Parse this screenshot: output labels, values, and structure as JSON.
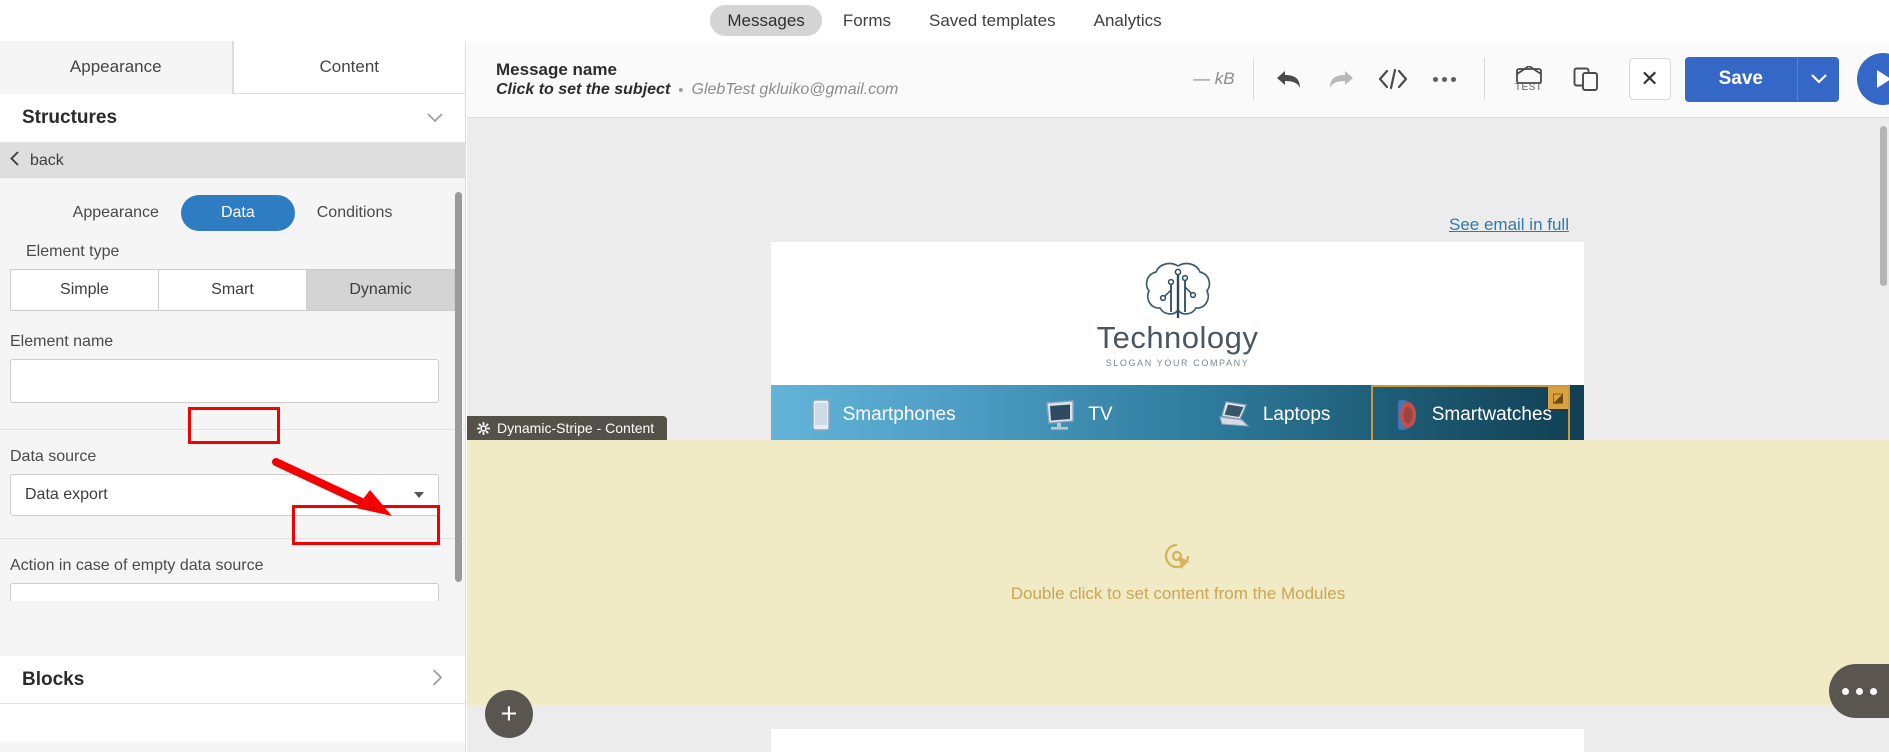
{
  "topnav": {
    "items": [
      {
        "label": "Messages",
        "active": true
      },
      {
        "label": "Forms",
        "active": false
      },
      {
        "label": "Saved templates",
        "active": false
      },
      {
        "label": "Analytics",
        "active": false
      }
    ]
  },
  "left_panel": {
    "top_tabs": [
      {
        "label": "Appearance",
        "active": true
      },
      {
        "label": "Content",
        "active": false
      }
    ],
    "structures_title": "Structures",
    "back_label": "back",
    "sub_tabs": [
      {
        "label": "Appearance",
        "active": false
      },
      {
        "label": "Data",
        "active": true
      },
      {
        "label": "Conditions",
        "active": false
      }
    ],
    "element_type_label": "Element type",
    "element_types": [
      {
        "label": "Simple",
        "selected": false
      },
      {
        "label": "Smart",
        "selected": false
      },
      {
        "label": "Dynamic",
        "selected": true
      }
    ],
    "element_name_label": "Element name",
    "element_name_value": "",
    "element_name_placeholder": "",
    "data_source_label": "Data source",
    "data_source_value": "Data export",
    "empty_action_label": "Action in case of empty data source",
    "blocks_title": "Blocks",
    "highlight_color": "#f40000",
    "accent_color": "#2e7cc2"
  },
  "editor_header": {
    "message_name": "Message name",
    "subject_placeholder": "Click to set the subject",
    "separator": "•",
    "sender": "GlebTest gkluiko@gmail.com",
    "size": "— kB",
    "icons": [
      {
        "name": "undo-icon",
        "title": "Undo"
      },
      {
        "name": "redo-icon",
        "title": "Redo"
      },
      {
        "name": "code-icon",
        "title": "</>"
      },
      {
        "name": "more-icon",
        "title": "More"
      },
      {
        "name": "test-email-icon",
        "title": "TEST"
      },
      {
        "name": "duplicate-icon",
        "title": "Copy"
      }
    ],
    "test_label": "TEST",
    "close_label": "✕",
    "save_label": "Save",
    "save_caret": "⌄",
    "play_label": "▶",
    "primary_color": "#3467c6"
  },
  "canvas": {
    "see_full_label": "See email in full",
    "email": {
      "brand": "Technology",
      "slogan": "SLOGAN YOUR COMPANY",
      "nav": [
        {
          "label": "Smartphones",
          "icon": "smartphone-icon",
          "selected": false
        },
        {
          "label": "TV",
          "icon": "tv-icon",
          "selected": false
        },
        {
          "label": "Laptops",
          "icon": "laptop-icon",
          "selected": false
        },
        {
          "label": "Smartwatches",
          "icon": "smartwatch-icon",
          "selected": true,
          "badge": "◪"
        }
      ]
    },
    "block_tag": "Dynamic-Stripe - Content",
    "block_tag_icon": "gear-icon",
    "content_hint": "Double click to set content from the Modules",
    "content_hint_icon": "click-target-icon",
    "add_block_label": "+",
    "side_menu_icon": "ellipsis-icon",
    "stripe_gradient_from": "#63b4d8",
    "stripe_gradient_to": "#113f54",
    "content_bg": "#f0eac5",
    "link_color": "#2e7ba6"
  }
}
